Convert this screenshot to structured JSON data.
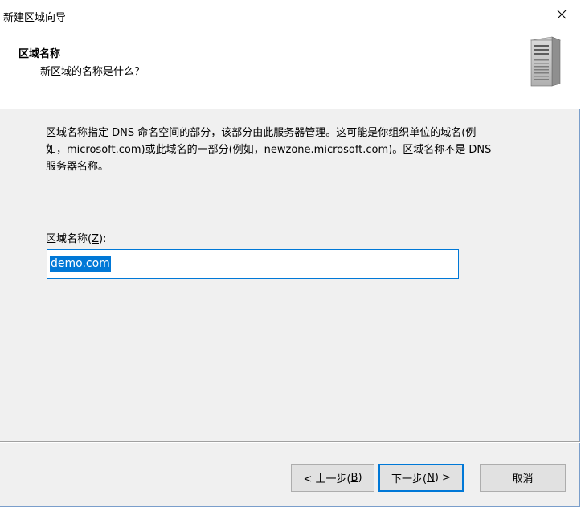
{
  "window": {
    "title": "新建区域向导",
    "close_glyph": "✕"
  },
  "header": {
    "title": "区域名称",
    "subtitle": "新区域的名称是什么？",
    "icon": "server-icon"
  },
  "body": {
    "description_line1": "区域名称指定 DNS 命名空间的部分，该部分由此服务器管理。这可能是你组织单位的域名(例",
    "description_line2": "如，microsoft.com)或此域名的一部分(例如，newzone.microsoft.com)。区域名称不是 DNS",
    "description_line3": "服务器名称。",
    "zone_label_prefix": "区域名称(",
    "zone_label_key": "Z",
    "zone_label_suffix": "):",
    "zone_value": "demo.com"
  },
  "buttons": {
    "back_prefix": "< 上一步(",
    "back_key": "B",
    "back_suffix": ")",
    "next_prefix": "下一步(",
    "next_key": "N",
    "next_suffix": ") >",
    "cancel": "取消"
  },
  "colors": {
    "accent": "#0078d7",
    "dialog_bg": "#f0f0f0",
    "header_bg": "#ffffff"
  }
}
